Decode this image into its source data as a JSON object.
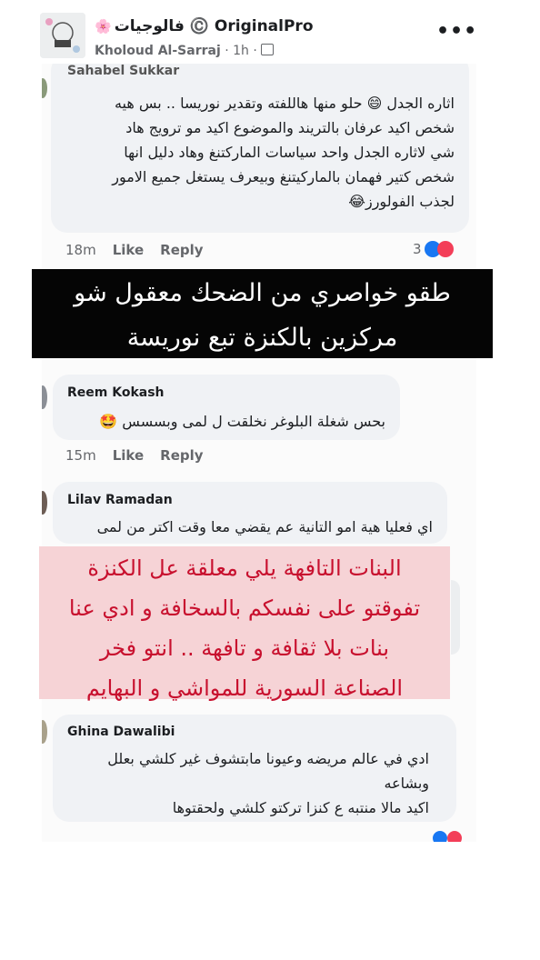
{
  "header": {
    "group_name": "فالوجيات ©️ OriginalPro",
    "flower_icon": "🌸",
    "author": "Kholoud Al-Sarraj",
    "meta": " · 1h · ",
    "more": "•••"
  },
  "comments": [
    {
      "name": "Sahabel Sukkar",
      "text": "اثاره الجدل 😄 حلو منها هاللفته وتقدير نوريسا .. بس هيه\nشخص اكيد عرفان بالتريند والموضوع اكيد مو ترويج هاد\nشي لاثاره الجدل واحد سياسات الماركتنغ وهاد دليل انها\nشخص كتير فهمان بالماركيتنغ وبيعرف يستغل جميع الامور\nلجذب الفولورز😂",
      "time": "18m",
      "like": "Like",
      "reply": "Reply",
      "reactions": "3"
    },
    {
      "name": "Reem Kokash",
      "text": "بحس شغلة البلوغر نخلقت  ل لمى وبسسس 🤩",
      "time": "15m",
      "like": "Like",
      "reply": "Reply"
    },
    {
      "name": "Lilav Ramadan",
      "text": "اي فعليا هية امو التانية عم يقضي معا وقت اكتر من لمى"
    },
    {
      "name": "Ghina Dawalibi",
      "text": "ادي في عالم مريضه وعيونا مابتشوف غير كلشي  بعلل\nوبشاعه\nاكيد مالا منتبه ع كنزا تركتو كلشي ولحقتوها"
    }
  ],
  "overlay_black": {
    "line1": "طقو خواصري من الضحك معقول شو",
    "line2": "مركزين بالكنزة تبع نوريسة"
  },
  "overlay_pink": {
    "line1": "البنات التافهة يلي معلقة عل الكنزة",
    "line2": "تفوقتو على نفسكم بالسخافة و ادي عنا",
    "line3": "بنات بلا ثقافة و تافهة .. انتو فخر",
    "line4": "الصناعة السورية للمواشي و البهايم"
  },
  "colors": {
    "overlay_text_red": "#c8102e",
    "overlay_pink_bg": "#f6d3d6",
    "like_blue": "#1877f2",
    "heart_red": "#f33e58"
  }
}
